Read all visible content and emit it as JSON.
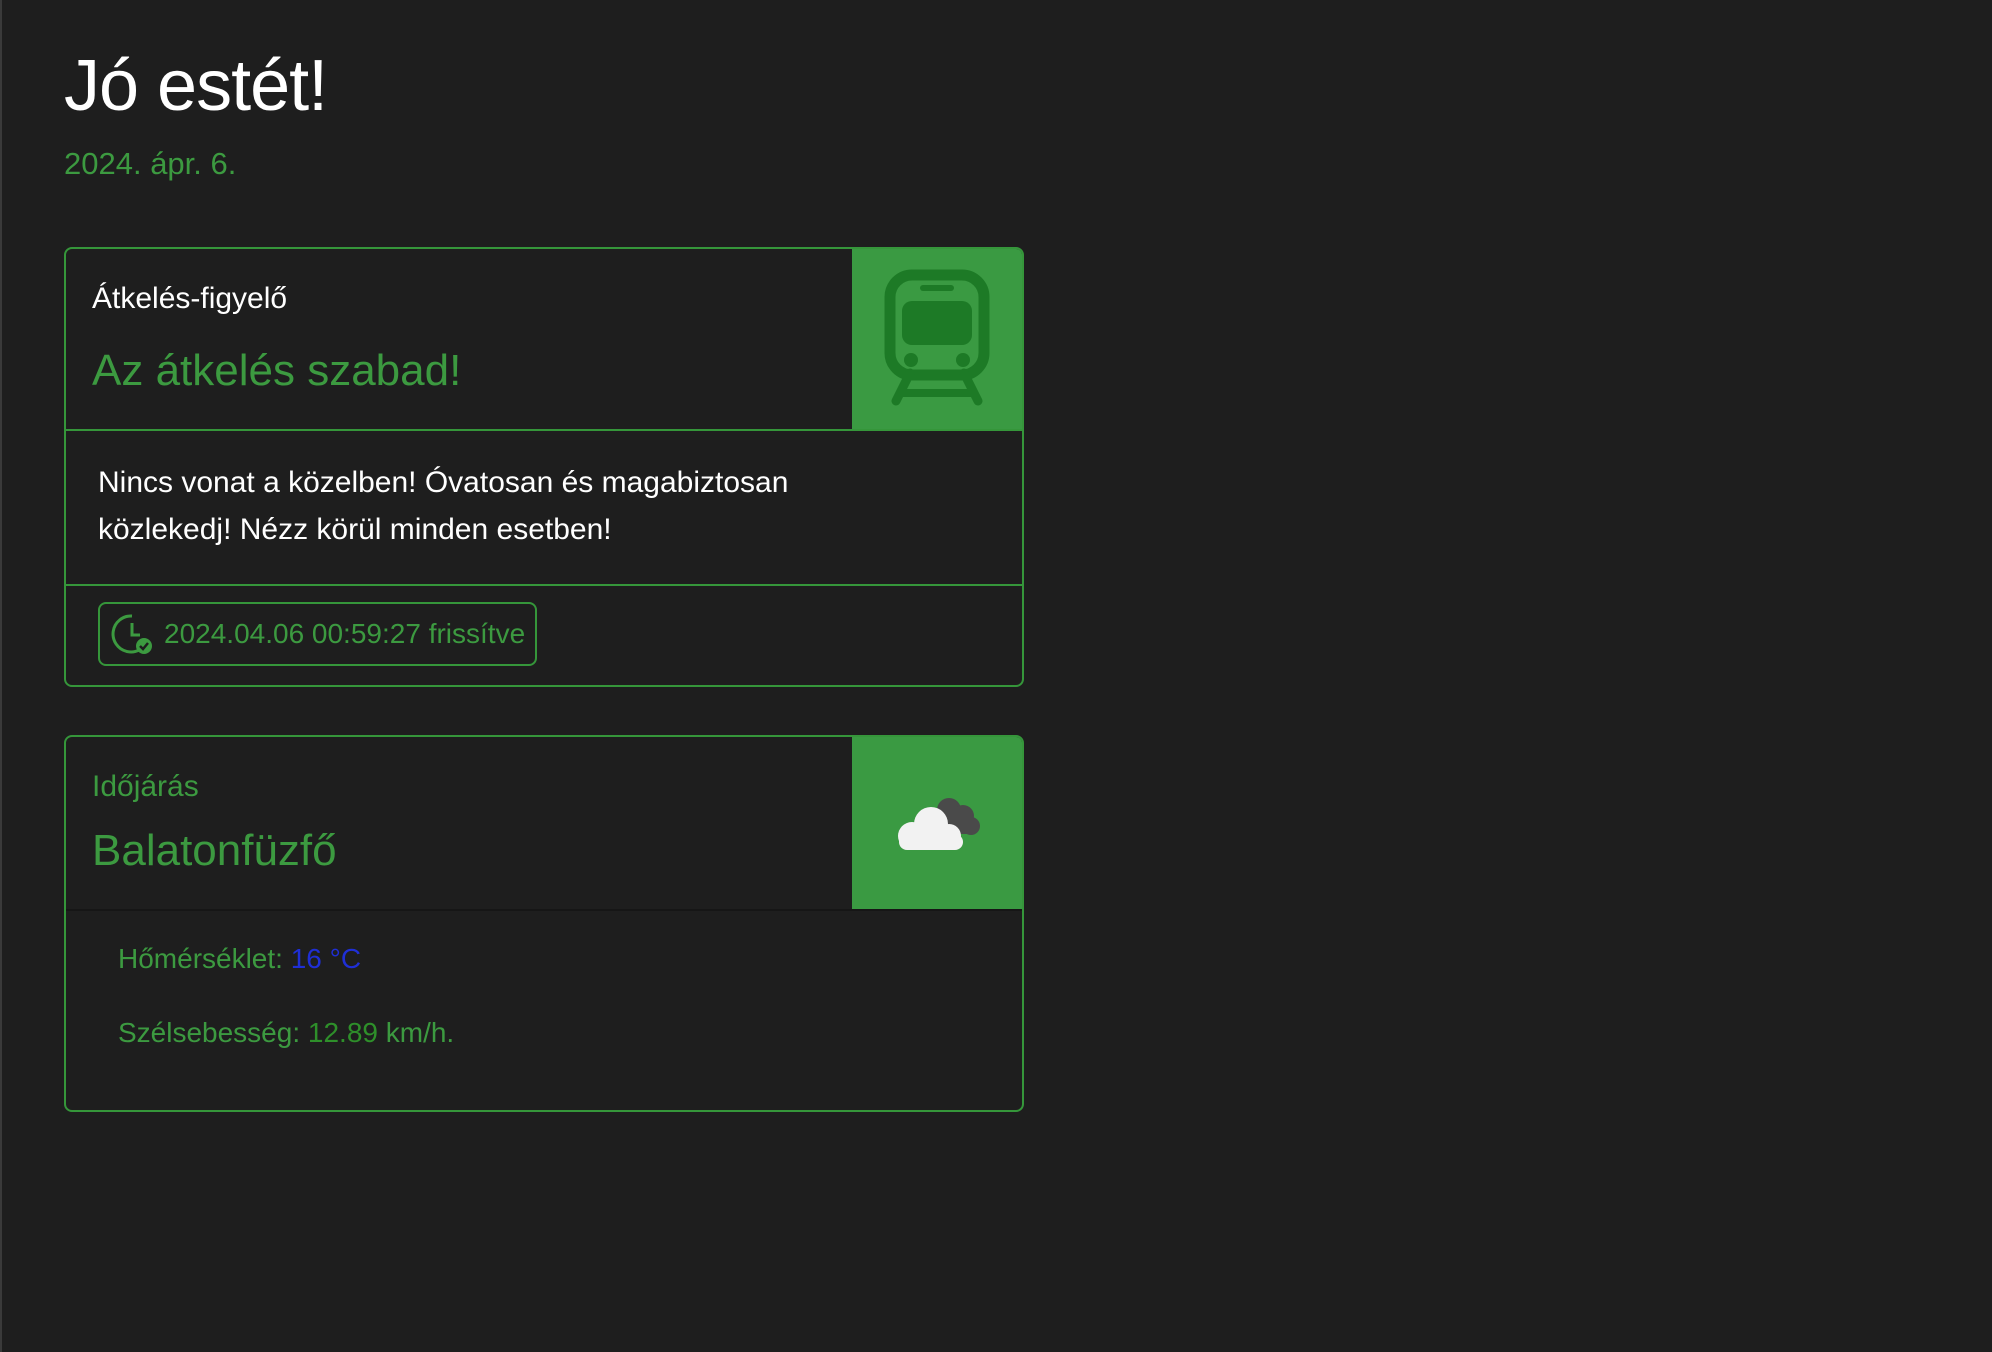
{
  "header": {
    "greeting": "Jó estét!",
    "date": "2024. ápr. 6."
  },
  "crossing": {
    "subtitle": "Átkelés-figyelő",
    "status": "Az átkelés szabad!",
    "icon": "train-icon",
    "message": "Nincs vonat a közelben! Óvatosan és magabiztosan közlekedj! Nézz körül minden esetben!",
    "updated": "2024.04.06 00:59:27 frissítve",
    "updated_icon": "clock-check-icon"
  },
  "weather": {
    "subtitle": "Időjárás",
    "location": "Balatonfüzfő",
    "icon": "cloud-icon",
    "temperature_label": "Hőmérséklet:",
    "temperature_value": "16 °C",
    "wind_label": "Szélsebesség:",
    "wind_value": "12.89",
    "wind_unit": "km/h."
  },
  "colors": {
    "background": "#1e1e1e",
    "accent": "#3a9a42",
    "temperature": "#1f2fd6"
  }
}
